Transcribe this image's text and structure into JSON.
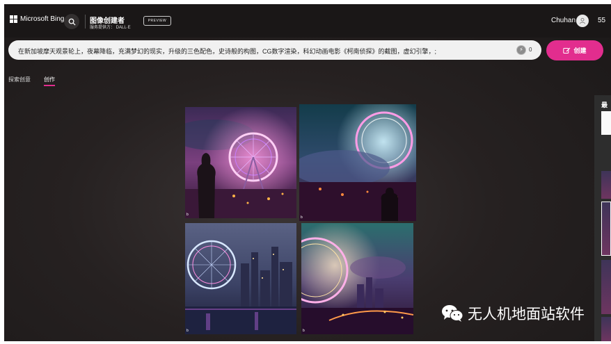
{
  "header": {
    "brand": "Microsoft Bing",
    "app_title": "图像创建者",
    "app_subtitle": "服务提供方： DALL·E",
    "preview_badge": "PREVIEW",
    "user_name": "Chuhan",
    "points": "55"
  },
  "prompt": {
    "text": "在新加坡摩天观景轮上，夜幕降临，充满梦幻的现实，升级的三色配色，史诗般的构图，CG数字渲染，科幻动画电影《柯南侦探》的截图，虚幻引擎，;",
    "boost_count": "0",
    "create_label": "创建"
  },
  "tabs": {
    "explore": "探索创意",
    "create": "创作"
  },
  "images": [
    {
      "name": "ferris-wheel-image-1",
      "badge": "b"
    },
    {
      "name": "ferris-wheel-image-2",
      "badge": "b"
    },
    {
      "name": "ferris-wheel-image-3",
      "badge": "b"
    },
    {
      "name": "ferris-wheel-image-4",
      "badge": "b"
    }
  ],
  "side_panel": {
    "label": "最"
  },
  "watermark": {
    "text": "无人机地面站软件",
    "icon": "wechat-icon"
  },
  "colors": {
    "accent": "#e22d8e",
    "header_bg": "#1a1717",
    "prompt_bg": "#f1f1f1"
  }
}
